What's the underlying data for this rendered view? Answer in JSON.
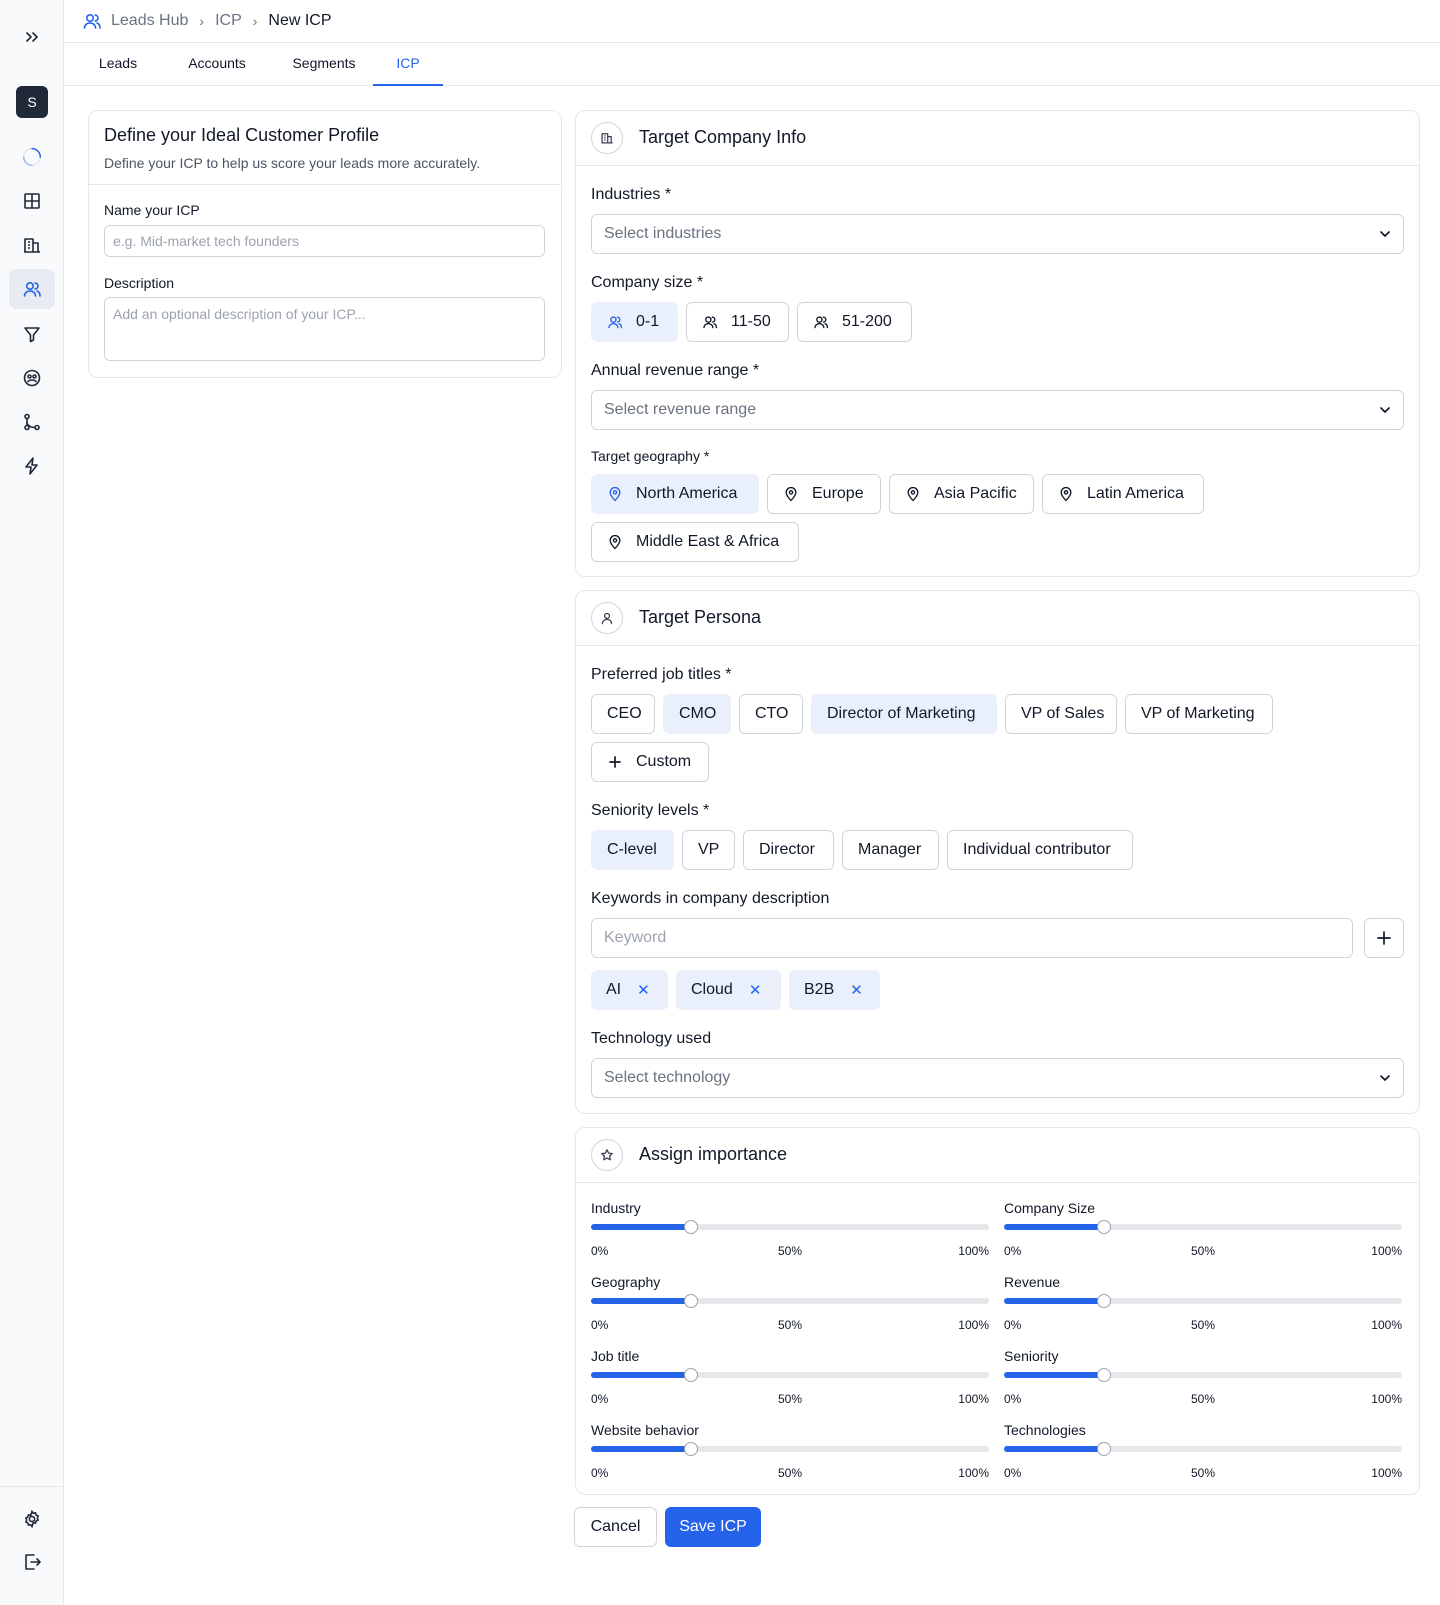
{
  "sidebar": {
    "avatar_initial": "S"
  },
  "breadcrumb": {
    "items": [
      "Leads Hub",
      "ICP",
      "New ICP"
    ]
  },
  "tabs": [
    "Leads",
    "Accounts",
    "Segments",
    "ICP"
  ],
  "active_tab": "ICP",
  "define": {
    "title": "Define your Ideal Customer Profile",
    "subtitle": "Define your ICP to help us score your leads more accurately.",
    "name_label": "Name your ICP",
    "name_placeholder": "e.g. Mid-market tech founders",
    "description_label": "Description",
    "description_placeholder": "Add an optional description of your ICP..."
  },
  "company": {
    "title": "Target Company Info",
    "industries_label": "Industries *",
    "industries_placeholder": "Select industries",
    "company_size_label": "Company size *",
    "company_sizes": [
      {
        "label": "0-1",
        "selected": true
      },
      {
        "label": "11-50",
        "selected": false
      },
      {
        "label": "51-200",
        "selected": false
      }
    ],
    "revenue_label": "Annual revenue range *",
    "revenue_placeholder": "Select revenue range",
    "geography_label": "Target geography *",
    "geographies": [
      {
        "label": "North America",
        "selected": true
      },
      {
        "label": "Europe",
        "selected": false
      },
      {
        "label": "Asia Pacific",
        "selected": false
      },
      {
        "label": "Latin America",
        "selected": false
      },
      {
        "label": "Middle East & Africa",
        "selected": false
      }
    ]
  },
  "persona": {
    "title": "Target Persona",
    "job_titles_label": "Preferred job titles *",
    "job_titles": [
      {
        "label": "CEO",
        "selected": false
      },
      {
        "label": "CMO",
        "selected": true
      },
      {
        "label": "CTO",
        "selected": false
      },
      {
        "label": "Director of Marketing",
        "selected": true
      },
      {
        "label": "VP of Sales",
        "selected": false
      },
      {
        "label": "VP of Marketing",
        "selected": false
      }
    ],
    "custom_label": "Custom",
    "seniority_label": "Seniority levels *",
    "seniority": [
      {
        "label": "C-level",
        "selected": true
      },
      {
        "label": "VP",
        "selected": false
      },
      {
        "label": "Director",
        "selected": false
      },
      {
        "label": "Manager",
        "selected": false
      },
      {
        "label": "Individual contributor",
        "selected": false
      }
    ],
    "keywords_label": "Keywords in company description",
    "keyword_placeholder": "Keyword",
    "keywords": [
      "AI",
      "Cloud",
      "B2B"
    ],
    "technology_label": "Technology used",
    "technology_placeholder": "Select technology"
  },
  "importance": {
    "title": "Assign importance",
    "scale": [
      "0%",
      "50%",
      "100%"
    ],
    "sliders": [
      {
        "label": "Industry",
        "value": 25
      },
      {
        "label": "Company Size",
        "value": 25
      },
      {
        "label": "Geography",
        "value": 25
      },
      {
        "label": "Revenue",
        "value": 25
      },
      {
        "label": "Job title",
        "value": 25
      },
      {
        "label": "Seniority",
        "value": 25
      },
      {
        "label": "Website behavior",
        "value": 25
      },
      {
        "label": "Technologies",
        "value": 25
      }
    ]
  },
  "actions": {
    "cancel": "Cancel",
    "save": "Save ICP"
  },
  "colors": {
    "accent": "#2563eb",
    "chip_selected_bg": "#eaf0fb",
    "border": "#d1d5db"
  }
}
